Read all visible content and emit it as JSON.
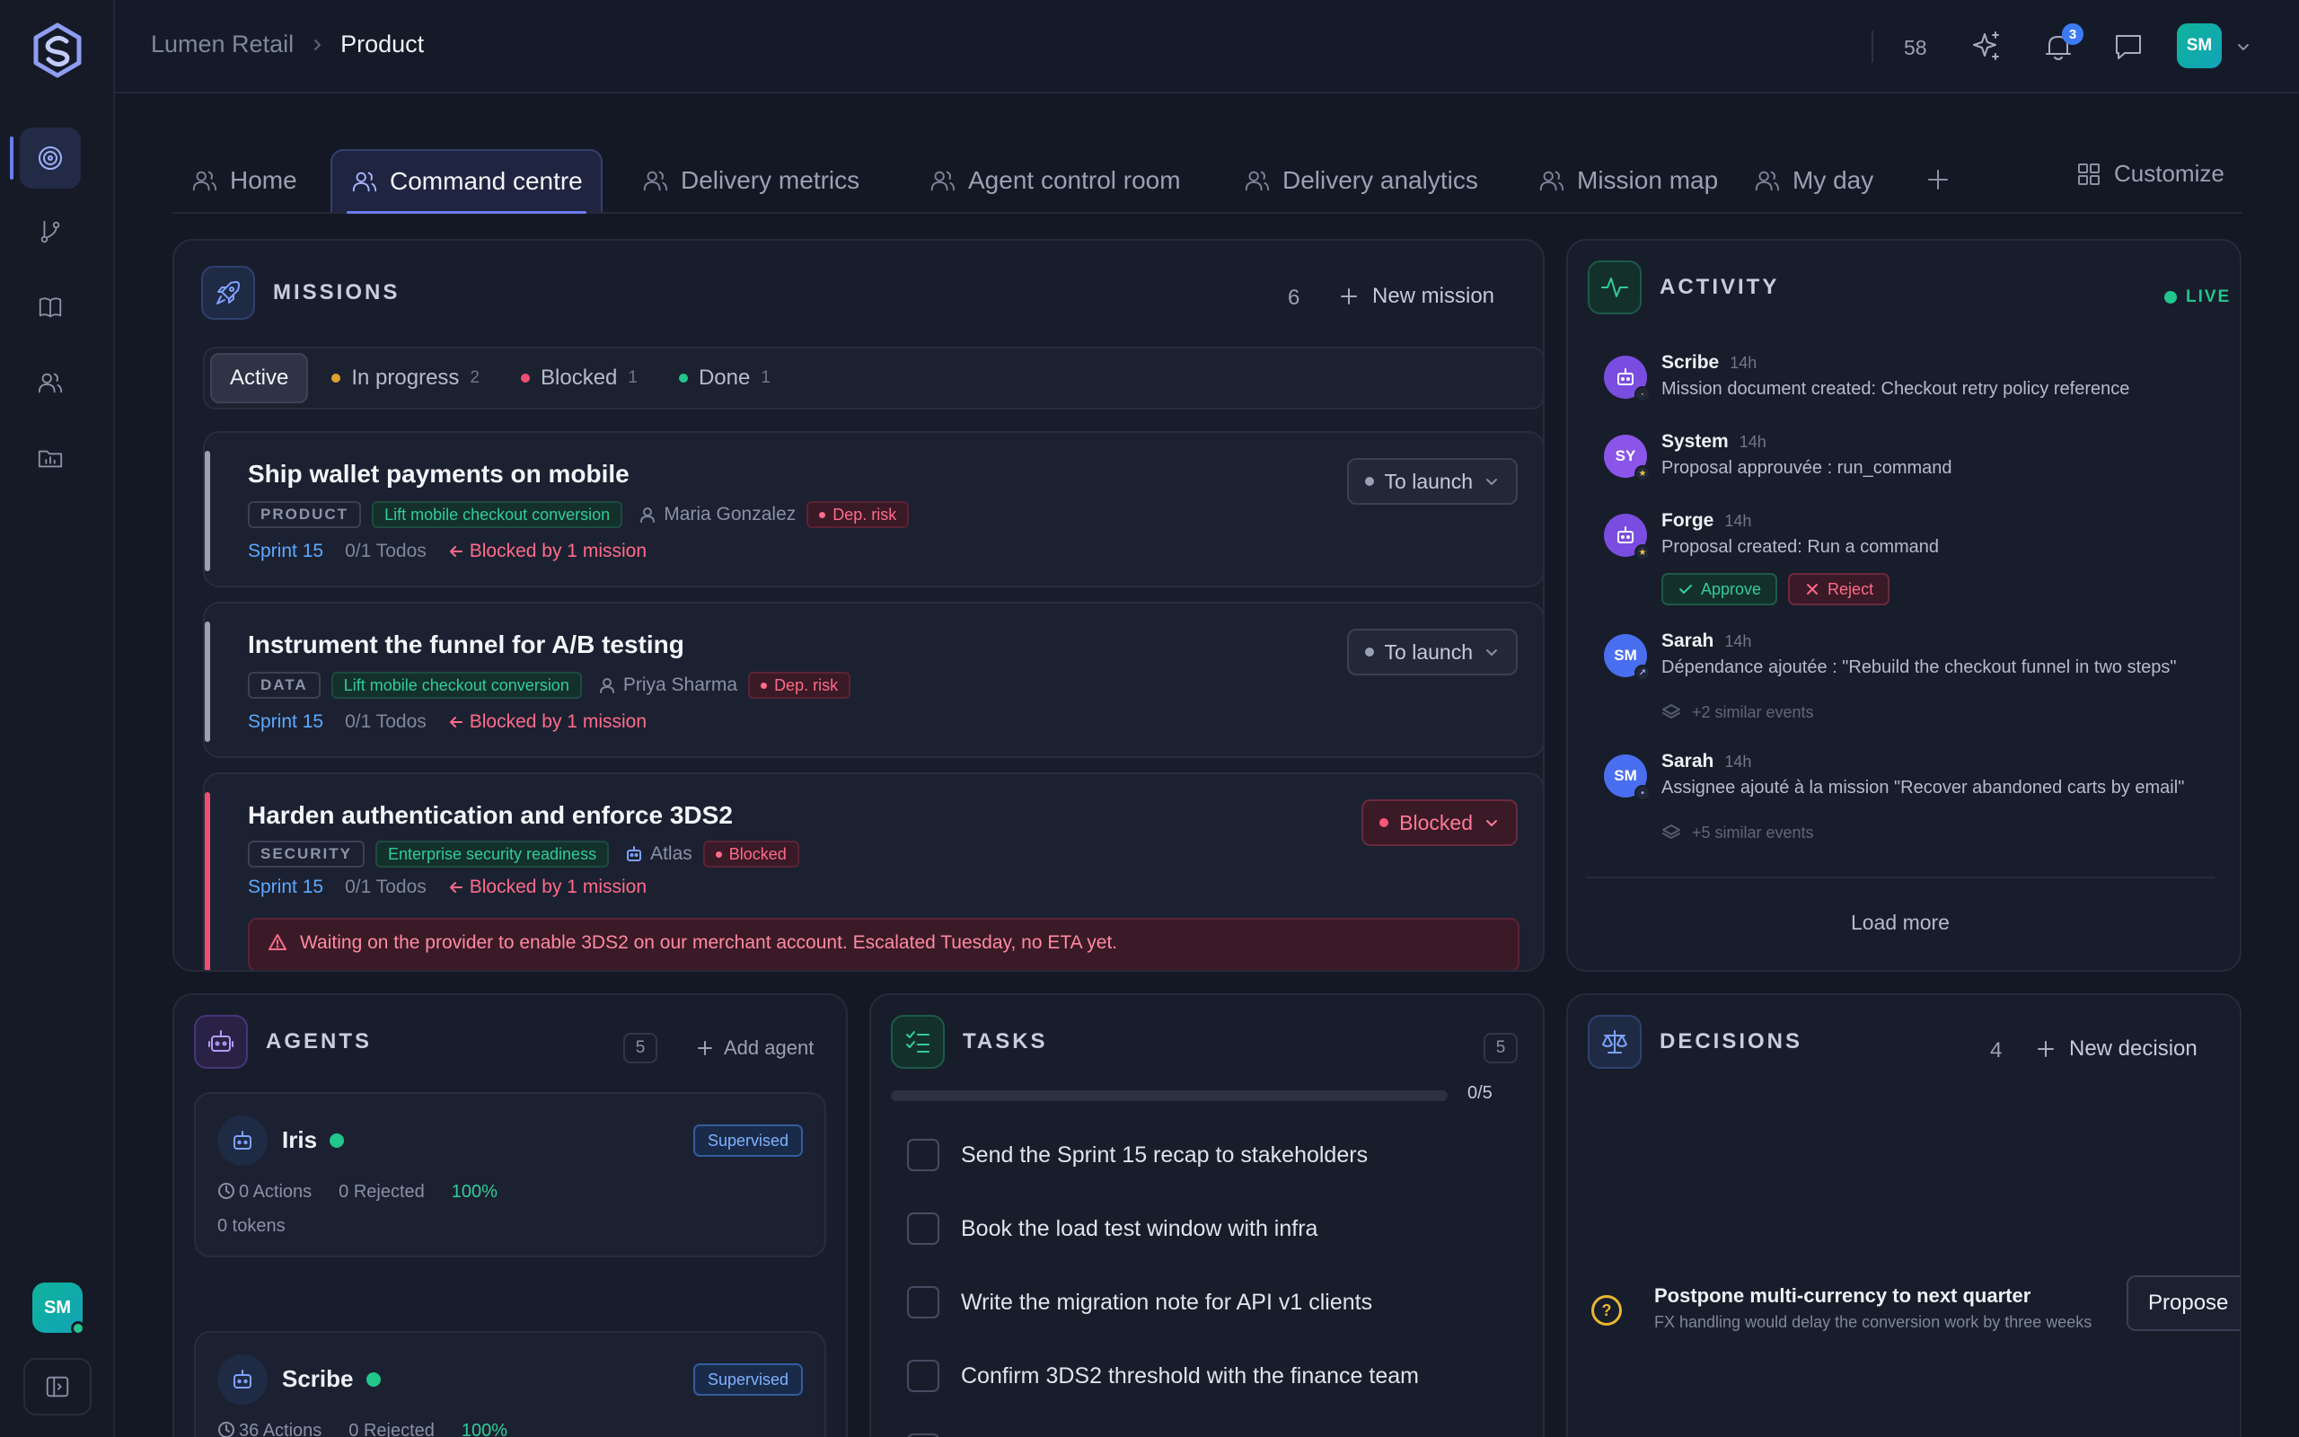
{
  "header": {
    "breadcrumb": [
      "Lumen Retail",
      "Product"
    ],
    "counter": "58",
    "notifications_badge": "3",
    "user_initials": "SM"
  },
  "rail": {
    "icons": [
      "target-icon",
      "branch-icon",
      "book-icon",
      "users-icon",
      "folder-chart-icon"
    ],
    "active": "target-icon",
    "user_initials": "SM"
  },
  "tabs": {
    "items": [
      {
        "label": "Home"
      },
      {
        "label": "Command centre",
        "active": true
      },
      {
        "label": "Delivery metrics"
      },
      {
        "label": "Agent control room"
      },
      {
        "label": "Delivery analytics"
      },
      {
        "label": "Mission map"
      },
      {
        "label": "My day"
      }
    ],
    "customize_label": "Customize"
  },
  "missions": {
    "title": "MISSIONS",
    "count": "6",
    "new_label": "New mission",
    "filters": [
      {
        "label": "Active",
        "count": "",
        "color": ""
      },
      {
        "label": "In progress",
        "count": "2",
        "color": "#e0a030"
      },
      {
        "label": "Blocked",
        "count": "1",
        "color": "#ef4f72"
      },
      {
        "label": "Done",
        "count": "1",
        "color": "#22c58b"
      }
    ],
    "items": [
      {
        "title": "Ship wallet payments on mobile",
        "category": "PRODUCT",
        "goal": "Lift mobile checkout conversion",
        "owner": "Maria Gonzalez",
        "risk": "Dep. risk",
        "sprint": "Sprint 15",
        "todos": "0/1 Todos",
        "blocked_by": "Blocked by 1 mission",
        "status": "To launch"
      },
      {
        "title": "Instrument the funnel for A/B testing",
        "category": "DATA",
        "goal": "Lift mobile checkout conversion",
        "owner": "Priya Sharma",
        "risk": "Dep. risk",
        "sprint": "Sprint 15",
        "todos": "0/1 Todos",
        "blocked_by": "Blocked by 1 mission",
        "status": "To launch"
      },
      {
        "title": "Harden authentication and enforce 3DS2",
        "category": "SECURITY",
        "goal": "Enterprise security readiness",
        "owner": "Atlas",
        "risk": "Blocked",
        "sprint": "Sprint 15",
        "todos": "0/1 Todos",
        "blocked_by": "Blocked by 1 mission",
        "status": "Blocked",
        "warning": "Waiting on the provider to enable 3DS2 on our merchant account. Escalated Tuesday, no ETA yet."
      }
    ]
  },
  "activity": {
    "title": "ACTIVITY",
    "live_label": "LIVE",
    "items": [
      {
        "name": "Scribe",
        "time": "14h",
        "text": "Mission document created: Checkout retry policy reference",
        "avatar": "",
        "color": "#7a4de0"
      },
      {
        "name": "System",
        "time": "14h",
        "text": "Proposal approuvée : run_command",
        "avatar": "SY",
        "color": "#8a55e8"
      },
      {
        "name": "Forge",
        "time": "14h",
        "text": "Proposal created: Run a command",
        "avatar": "",
        "color": "#7a4de0"
      },
      {
        "name": "Sarah",
        "time": "14h",
        "text": "Dépendance ajoutée : \"Rebuild the checkout funnel in two steps\"",
        "avatar": "SM",
        "color": "#4a6ef0"
      },
      {
        "name": "Sarah",
        "time": "14h",
        "text": "Assignee ajouté à la mission \"Recover abandoned carts by email\"",
        "avatar": "SM",
        "color": "#4a6ef0"
      }
    ],
    "similar": [
      "+2 similar events",
      "+5 similar events"
    ],
    "approve_label": "Approve",
    "reject_label": "Reject",
    "load_more_label": "Load more"
  },
  "agents": {
    "title": "AGENTS",
    "count": "5",
    "add_label": "Add agent",
    "items": [
      {
        "name": "Iris",
        "mode": "Supervised",
        "actions": "0 Actions",
        "rejected": "0 Rejected",
        "rate": "100%",
        "tokens": "0 tokens"
      },
      {
        "name": "Scribe",
        "mode": "Supervised",
        "actions": "36 Actions",
        "rejected": "0 Rejected",
        "rate": "100%",
        "tokens": ""
      }
    ]
  },
  "tasks": {
    "title": "TASKS",
    "count": "5",
    "progress_label": "0/5",
    "progress": 0,
    "items": [
      "Send the Sprint 15 recap to stakeholders",
      "Book the load test window with infra",
      "Write the migration note for API v1 clients",
      "Confirm 3DS2 threshold with the finance team"
    ]
  },
  "decisions": {
    "title": "DECISIONS",
    "count": "4",
    "new_label": "New decision",
    "items": [
      {
        "title": "Postpone multi-currency to next quarter",
        "description": "FX handling would delay the conversion work by three weeks",
        "action": "Propose"
      }
    ]
  }
}
